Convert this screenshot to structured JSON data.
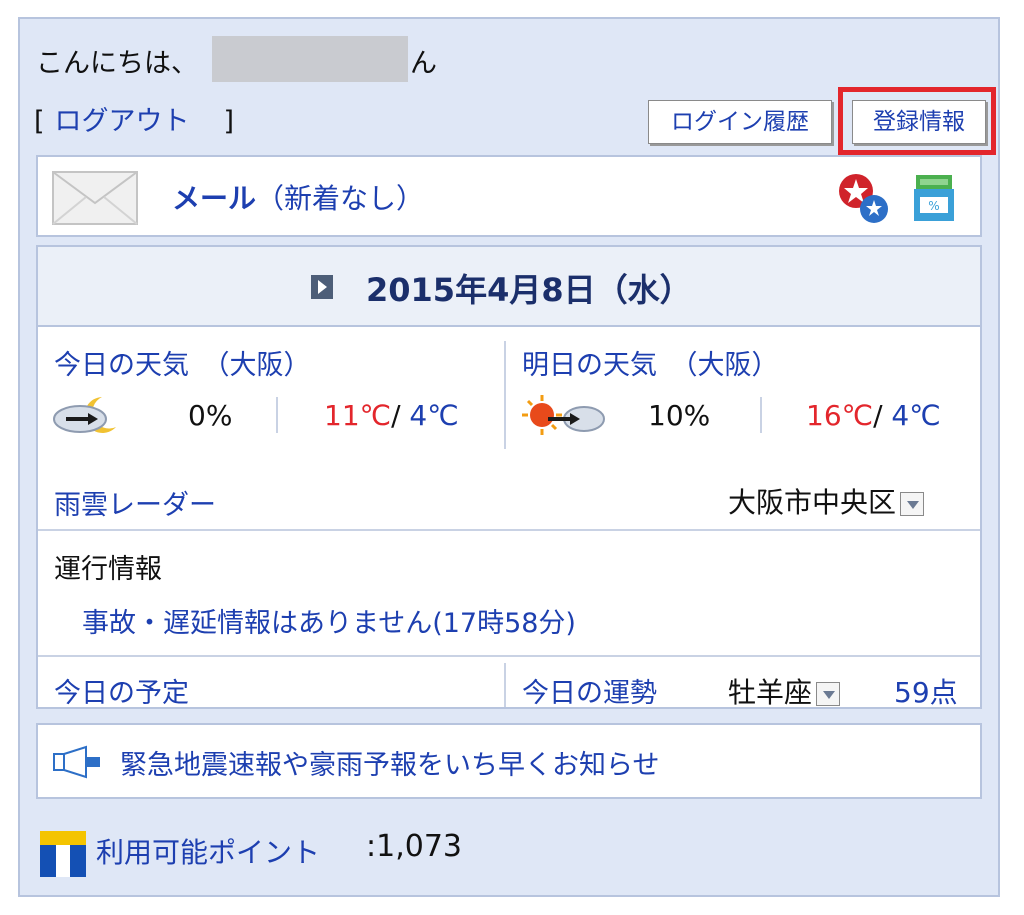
{
  "header": {
    "greeting_prefix": "こんにちは、",
    "greeting_suffix": "ん",
    "logout_open_bracket": "[",
    "logout_label": "ログアウト",
    "logout_close_bracket": "]",
    "login_history_button": "ログイン履歴",
    "register_info_button": "登録情報",
    "highlight_color": "#e3262c"
  },
  "mail": {
    "label": "メール",
    "status": "（新着なし）",
    "icons": [
      "envelope-icon",
      "star-badge-icon",
      "shopping-cart-icon"
    ]
  },
  "date": {
    "text": "2015年4月8日（水）"
  },
  "weather": {
    "today": {
      "title": "今日の天気　（大阪）",
      "icon": "cloudy-night-icon",
      "precip": "0%",
      "high": "11℃",
      "separator": "/",
      "low": "4℃"
    },
    "tomorrow": {
      "title": "明日の天気　（大阪）",
      "icon": "sunny-then-cloudy-icon",
      "precip": "10%",
      "high": "16℃",
      "separator": "/",
      "low": "4℃"
    },
    "radar_link": "雨雲レーダー",
    "area_select": "大阪市中央区"
  },
  "traffic": {
    "title": "運行情報",
    "message": "事故・遅延情報はありません(17時58分)"
  },
  "today": {
    "schedule_link": "今日の予定",
    "fortune_label": "今日の運勢",
    "fortune_sign": "牡羊座",
    "fortune_score": "59点"
  },
  "alert": {
    "text": "緊急地震速報や豪雨予報をいち早くお知らせ"
  },
  "points": {
    "label": "利用可能ポイント",
    "value": ":1,073"
  },
  "colors": {
    "panel_bg": "#dfe7f6",
    "link": "#1d3fb0",
    "high_temp": "#e3262c"
  }
}
